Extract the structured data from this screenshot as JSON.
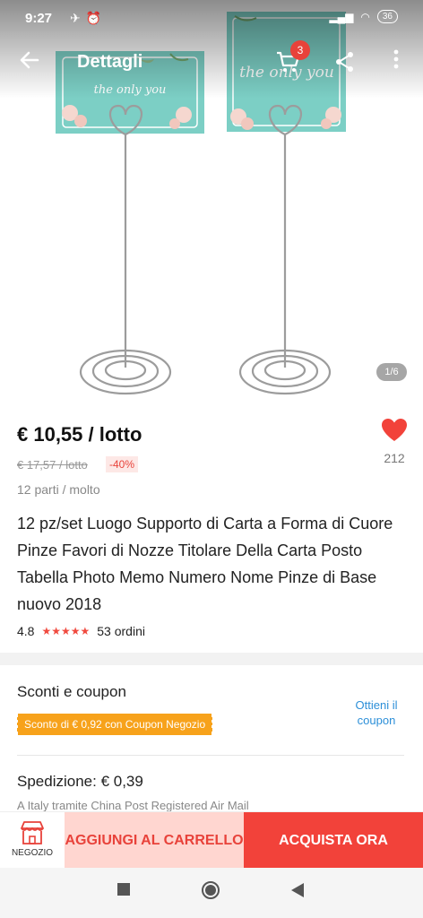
{
  "status": {
    "time": "9:27",
    "battery": "36"
  },
  "header": {
    "title": "Dettagli",
    "cart_count": "3"
  },
  "gallery": {
    "pager": "1/6",
    "card_text": "the only you"
  },
  "product": {
    "price": "€ 10,55 / lotto",
    "old_price": "€ 17,57 / lotto",
    "discount": "-40%",
    "likes": "212",
    "parts": "12 parti / molto",
    "title": "12 pz/set Luogo Supporto di Carta a Forma di Cuore Pinze Favori di Nozze Titolare Della Carta Posto Tabella Photo Memo Numero Nome Pinze di Base nuovo 2018",
    "rating": "4.8",
    "stars": "★★★★★",
    "orders": "53 ordini"
  },
  "coupons": {
    "title": "Sconti e coupon",
    "tag": "Sconto di € 0,92 con Coupon Negozio",
    "link": "Ottieni il coupon"
  },
  "shipping": {
    "title": "Spedizione: € 0,39",
    "sub": "A Italy tramite China Post Registered Air Mail"
  },
  "actions": {
    "store_label": "NEGOZIO",
    "add_to_cart": "AGGIUNGI AL CARRELLO",
    "buy_now": "ACQUISTA ORA"
  },
  "colors": {
    "accent": "#f2423a",
    "coupon": "#f7a21b",
    "link": "#2c8fd8",
    "card": "#7ccfc5"
  }
}
